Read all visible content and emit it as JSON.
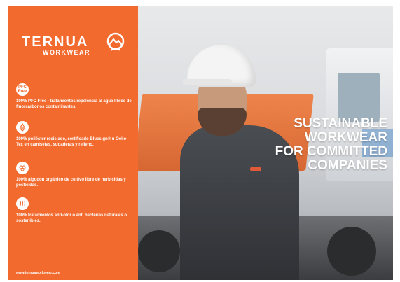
{
  "brand": {
    "name": "TERNUA",
    "sub": "WORKWEAR"
  },
  "features": [
    {
      "icon": "pfc-free-icon",
      "badge": "PFC Free",
      "text": "100% PFC Free - tratamientos repelencia al agua libres de fluorcarbonos contaminantes."
    },
    {
      "icon": "recycled-icon",
      "badge": "",
      "text": "100% poliéster reciclado, certificado Bluesign® u Oeko-Tex en camisetas, sudaderas y relleno."
    },
    {
      "icon": "organic-cotton-icon",
      "badge": "",
      "text": "100% algodón orgánico de cultivo libre de herbicidas y pesticidas."
    },
    {
      "icon": "anti-odor-icon",
      "badge": "",
      "text": "100% tratamientos anti-olor o anti bacterias naturales o sostenibles."
    }
  ],
  "website": "www.ternuaworkwear.com",
  "headline": [
    "SUSTAINABLE",
    "WORKWEAR",
    "FOR COMMITTED",
    "COMPANIES"
  ],
  "colors": {
    "panel": "#f26a2e",
    "text": "#ffffff"
  }
}
